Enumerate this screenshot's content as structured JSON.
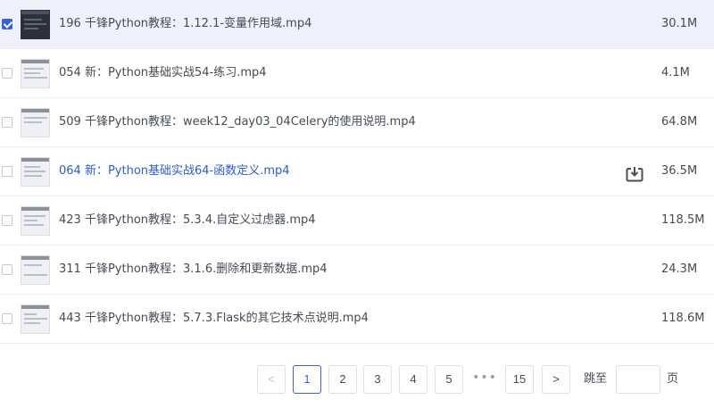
{
  "files": [
    {
      "name": "196 千锋Python教程：1.12.1-变量作用域.mp4",
      "size": "30.1M",
      "selected": true
    },
    {
      "name": "054 新：Python基础实战54-练习.mp4",
      "size": "4.1M",
      "selected": false
    },
    {
      "name": "509 千锋Python教程：week12_day03_04Celery的使用说明.mp4",
      "size": "64.8M",
      "selected": false
    },
    {
      "name": "064 新：Python基础实战64-函数定义.mp4",
      "size": "36.5M",
      "selected": false,
      "hovered": true
    },
    {
      "name": "423 千锋Python教程：5.3.4.自定义过虑器.mp4",
      "size": "118.5M",
      "selected": false
    },
    {
      "name": "311 千锋Python教程：3.1.6.删除和更新数据.mp4",
      "size": "24.3M",
      "selected": false
    },
    {
      "name": "443 千锋Python教程：5.7.3.Flask的其它技术点说明.mp4",
      "size": "118.6M",
      "selected": false
    }
  ],
  "row_actions": {
    "download_icon": "download-icon"
  },
  "pagination": {
    "prev": "<",
    "pages": [
      "1",
      "2",
      "3",
      "4",
      "5"
    ],
    "ellipsis": "•••",
    "last": "15",
    "next": ">",
    "current": "1",
    "jump_label": "跳至",
    "jump_value": "",
    "page_suffix": "页"
  },
  "colors": {
    "accent": "#3b5fd9",
    "link": "#2e5cc9",
    "selected_row": "#eef0fa"
  }
}
